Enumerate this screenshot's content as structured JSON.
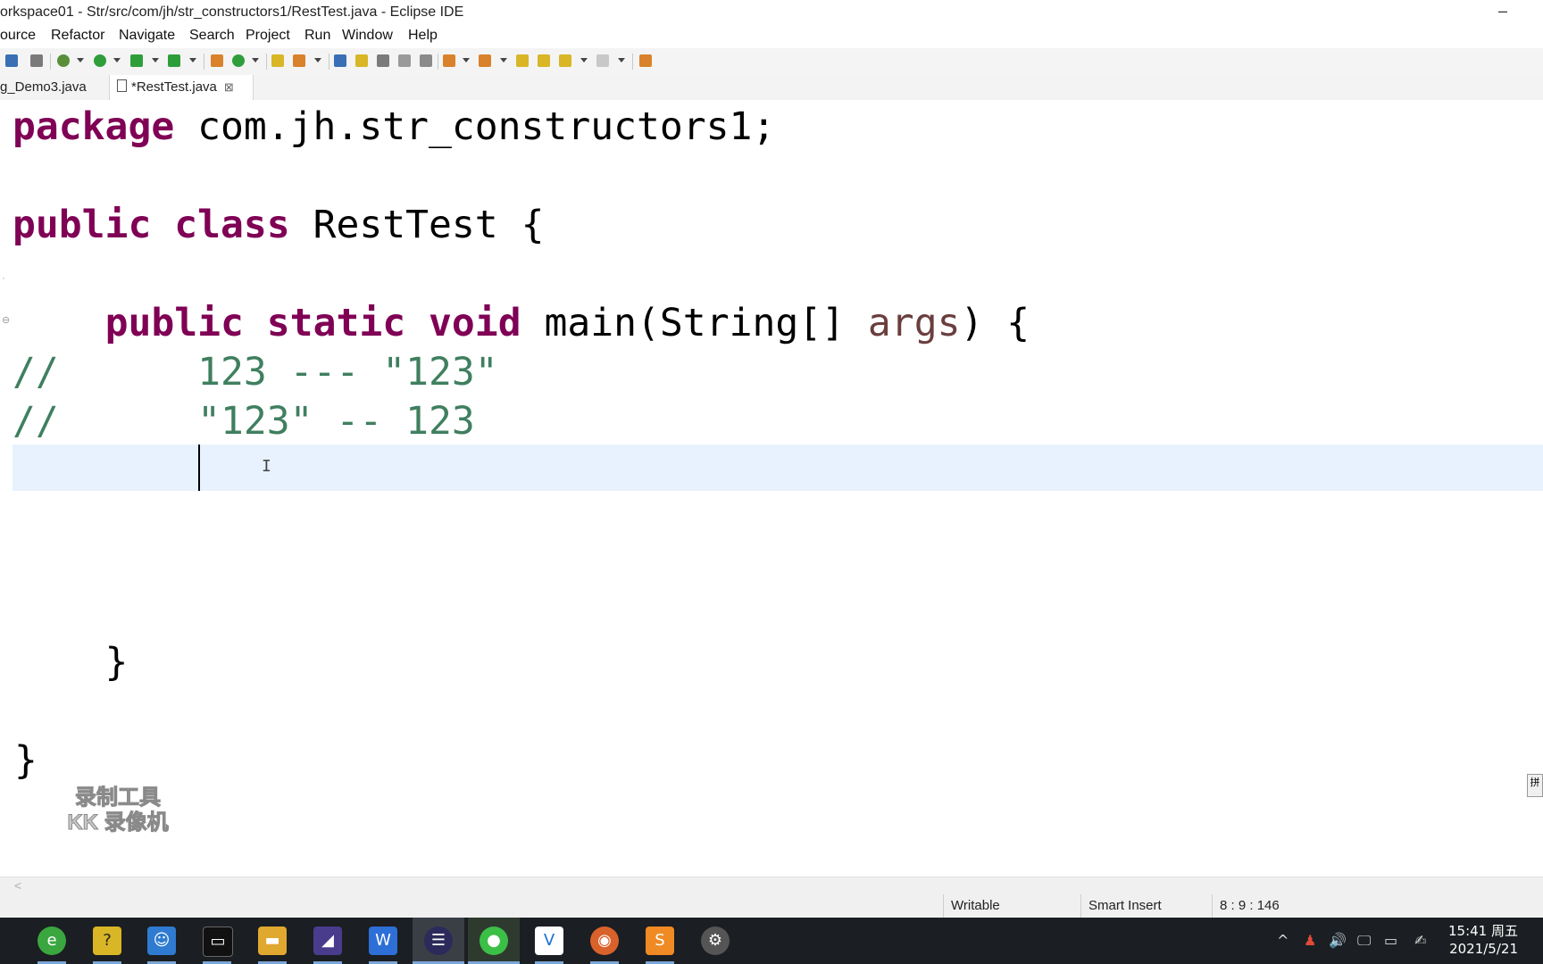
{
  "window": {
    "title": "orkspace01 - Str/src/com/jh/str_constructors1/RestTest.java - Eclipse IDE",
    "minimize_glyph": "–"
  },
  "menu": [
    "ource",
    "Refactor",
    "Navigate",
    "Search",
    "Project",
    "Run",
    "Window",
    "Help"
  ],
  "toolbar": {
    "icons": [
      "save-icon",
      "skip-breakpoints-icon",
      "debug-icon",
      "run-icon",
      "coverage-icon",
      "external-tools-icon",
      "new-java-package-icon",
      "new-class-icon",
      "open-type-icon",
      "search-icon",
      "toggle-mark-occurrences-icon",
      "highlight-icon",
      "block-selection-icon",
      "show-whitespace-icon",
      "next-annotation-icon",
      "previous-annotation-icon",
      "last-edit-location-icon",
      "back-icon",
      "forward-icon",
      "open-perspective-icon"
    ],
    "colors": {
      "green": "#2e9e3a",
      "orange": "#d9822b",
      "blue": "#3a6fb5",
      "gray": "#7a7a7a",
      "yellow": "#d8b626"
    }
  },
  "tabs": [
    {
      "label": "g_Demo3.java",
      "active": false
    },
    {
      "label": "*RestTest.java",
      "active": true,
      "close": "⊠"
    }
  ],
  "editor": {
    "colors": {
      "keyword": "#7f0055",
      "comment": "#3f7f5f",
      "parameter": "#6a3e3e",
      "current_line": "#e8f2fe"
    },
    "lines": {
      "l1": {
        "kw": "package",
        "rest": " com.jh.str_constructors1;"
      },
      "l3": {
        "kw1": "public",
        "kw2": "class",
        "rest": " RestTest {"
      },
      "l5": {
        "indent": "    ",
        "kw1": "public",
        "kw2": "static",
        "kw3": "void",
        "rest": " main(String[] ",
        "param": "args",
        "end": ") {"
      },
      "l6": {
        "comment": "//      123 --- \"123\""
      },
      "l7": {
        "comment": "//      \"123\" -- 123"
      },
      "l11": {
        "text": "    }"
      },
      "l13": {
        "text": "}"
      }
    },
    "fold_marker": "⊖",
    "cursor_glyph": "I"
  },
  "watermark": {
    "line1": "录制工具",
    "line2": "KK 录像机"
  },
  "right_edge_icon": "拼",
  "scrollbar": {
    "left_arrow": "<"
  },
  "status": {
    "writable": "Writable",
    "insert_mode": "Smart Insert",
    "position": "8 : 9 : 146"
  },
  "taskbar": {
    "apps": [
      "browser-360-icon",
      "notes-icon",
      "contacts-icon",
      "terminal-icon",
      "file-explorer-icon",
      "dolphin-icon",
      "wps-writer-icon",
      "eclipse-icon",
      "wechat-icon",
      "vscode-icon",
      "fox-app-icon",
      "sublime-icon",
      "settings-icon"
    ],
    "tray": {
      "chevron": "^",
      "volume": "🔊",
      "network": "🖵",
      "battery": "▭",
      "pen": "✍"
    },
    "time": "15:41 周五",
    "date": "2021/5/21"
  }
}
